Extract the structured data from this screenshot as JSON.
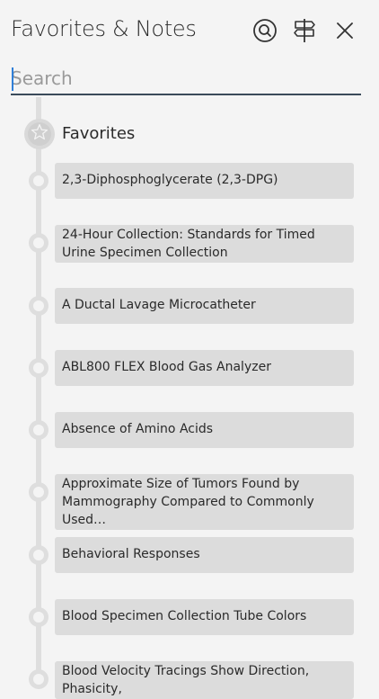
{
  "header": {
    "title": "Favorites & Notes",
    "icons": [
      "search-icon",
      "signpost-icon",
      "close-icon"
    ]
  },
  "search": {
    "placeholder": "Search",
    "value": ""
  },
  "favorites_section": {
    "label": "Favorites",
    "icon": "star-icon"
  },
  "items": [
    {
      "label": "2,3-Diphosphoglycerate (2,3-DPG)"
    },
    {
      "label": "24-Hour Collection: Standards for Timed Urine Specimen Collection"
    },
    {
      "label": "A Ductal Lavage Microcatheter"
    },
    {
      "label": "ABL800 FLEX Blood Gas Analyzer"
    },
    {
      "label": "Absence of Amino Acids"
    },
    {
      "label": "Approximate Size of Tumors Found by Mammography Compared to Commonly Used…"
    },
    {
      "label": "Behavioral Responses"
    },
    {
      "label": "Blood Specimen Collection Tube Colors"
    },
    {
      "label": "Blood Velocity Tracings Show Direction, Phasicity,"
    }
  ],
  "colors": {
    "accent": "#2f7fd8",
    "card": "#dcdcdc",
    "timeline": "#dedede",
    "background": "#f4f4f4"
  }
}
